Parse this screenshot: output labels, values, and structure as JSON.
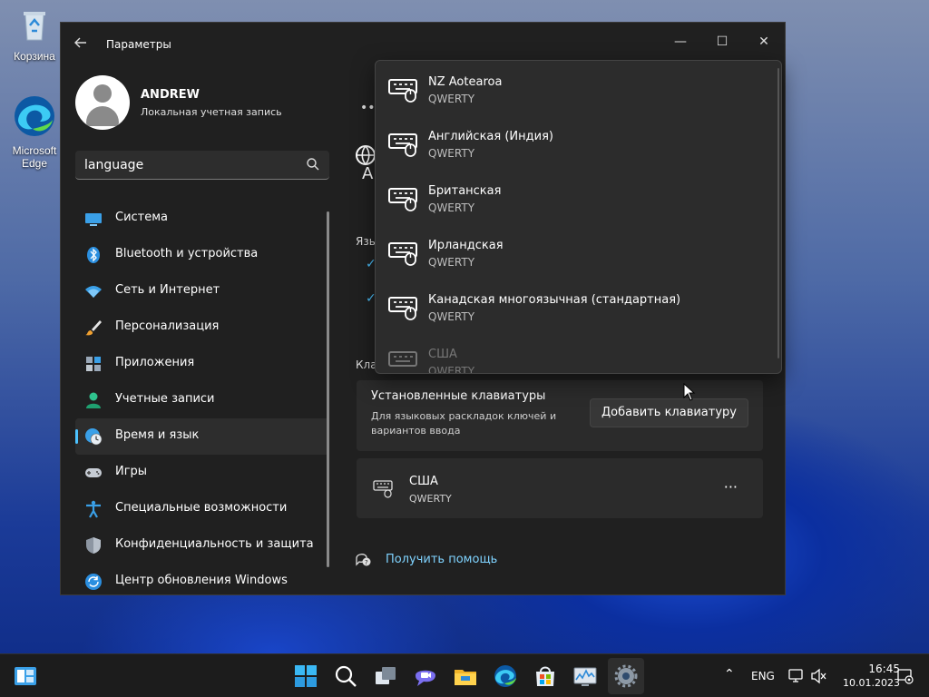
{
  "desktop": {
    "icons": [
      {
        "label": "Корзина"
      },
      {
        "label": "Microsoft Edge"
      }
    ]
  },
  "window": {
    "title": "Параметры",
    "controls": {
      "minimize": "—",
      "maximize": "☐",
      "close": "✕"
    }
  },
  "profile": {
    "name": "ANDREW",
    "account_type": "Локальная учетная запись"
  },
  "search": {
    "value": "language"
  },
  "sidebar": {
    "items": [
      {
        "label": "Система",
        "icon": "monitor-icon"
      },
      {
        "label": "Bluetooth и устройства",
        "icon": "bluetooth-icon"
      },
      {
        "label": "Сеть и Интернет",
        "icon": "wifi-icon"
      },
      {
        "label": "Персонализация",
        "icon": "brush-icon"
      },
      {
        "label": "Приложения",
        "icon": "apps-icon"
      },
      {
        "label": "Учетные записи",
        "icon": "person-icon"
      },
      {
        "label": "Время и язык",
        "icon": "globe-clock-icon",
        "active": true
      },
      {
        "label": "Игры",
        "icon": "gamepad-icon"
      },
      {
        "label": "Специальные возможности",
        "icon": "accessibility-icon"
      },
      {
        "label": "Конфиденциальность и защита",
        "icon": "shield-icon"
      },
      {
        "label": "Центр обновления Windows",
        "icon": "update-icon"
      }
    ]
  },
  "content": {
    "section_lang_partial": "Язы",
    "section_kb_partial": "Кла",
    "installed_card": {
      "title": "Установленные клавиатуры",
      "description": "Для языковых раскладок ключей и вариантов ввода",
      "add_button": "Добавить клавиатуру"
    },
    "keyboard": {
      "name": "США",
      "layout": "QWERTY",
      "more": "···"
    },
    "help": "Получить помощь"
  },
  "dropdown": {
    "items": [
      {
        "name": "NZ Aotearoa",
        "layout": "QWERTY"
      },
      {
        "name": "Английская (Индия)",
        "layout": "QWERTY"
      },
      {
        "name": "Британская",
        "layout": "QWERTY"
      },
      {
        "name": "Ирландская",
        "layout": "QWERTY"
      },
      {
        "name": "Канадская многоязычная (стандартная)",
        "layout": "QWERTY"
      },
      {
        "name": "США",
        "layout": "QWERTY"
      }
    ]
  },
  "taskbar": {
    "language": "ENG",
    "time": "16:45",
    "date": "10.01.2023"
  },
  "colors": {
    "accent": "#4cc2ff",
    "window_bg": "#202020",
    "card_bg": "#2b2b2b",
    "link": "#7fd3ff"
  }
}
